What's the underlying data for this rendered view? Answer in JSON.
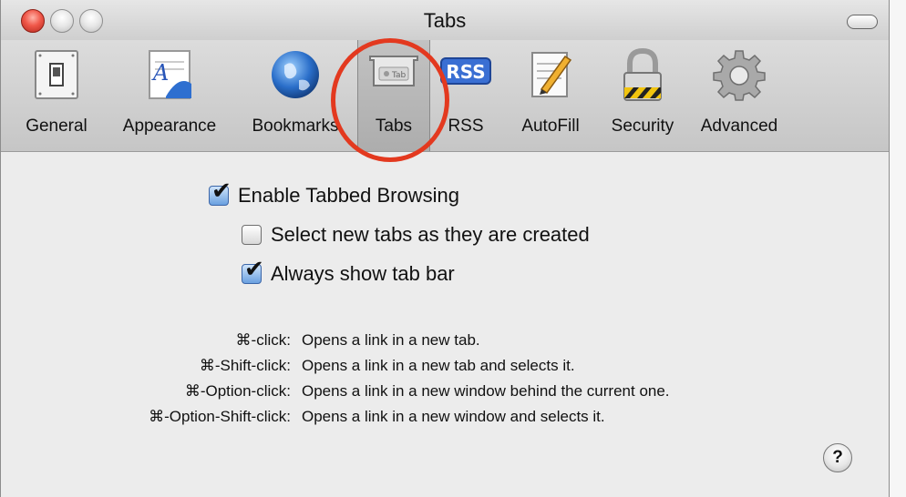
{
  "window": {
    "title": "Tabs"
  },
  "toolbar": {
    "items": [
      {
        "label": "General",
        "icon": "light-switch-icon"
      },
      {
        "label": "Appearance",
        "icon": "font-document-icon"
      },
      {
        "label": "Bookmarks",
        "icon": "globe-icon"
      },
      {
        "label": "Tabs",
        "icon": "tab-icon",
        "selected": true,
        "icon_text": "Tab"
      },
      {
        "label": "RSS",
        "icon": "rss-icon",
        "icon_text": "RSS"
      },
      {
        "label": "AutoFill",
        "icon": "pencil-form-icon"
      },
      {
        "label": "Security",
        "icon": "padlock-icon"
      },
      {
        "label": "Advanced",
        "icon": "gear-icon"
      }
    ]
  },
  "options": {
    "enable_tabbed_browsing": {
      "label": "Enable Tabbed Browsing",
      "checked": true
    },
    "select_new_tabs": {
      "label": "Select new tabs as they are created",
      "checked": false
    },
    "always_show_tab_bar": {
      "label": "Always show tab bar",
      "checked": true
    }
  },
  "shortcuts": [
    {
      "key": "⌘-click:",
      "desc": "Opens a link in a new tab."
    },
    {
      "key": "⌘-Shift-click:",
      "desc": "Opens a link in a new tab and selects it."
    },
    {
      "key": "⌘-Option-click:",
      "desc": "Opens a link in a new window behind the current one."
    },
    {
      "key": "⌘-Option-Shift-click:",
      "desc": "Opens a link in a new window and selects it."
    }
  ],
  "help": {
    "label": "?"
  },
  "colors": {
    "annotation": "#e3391f",
    "window_bg": "#ececec",
    "checkbox_checked": "#6aa0e0"
  }
}
